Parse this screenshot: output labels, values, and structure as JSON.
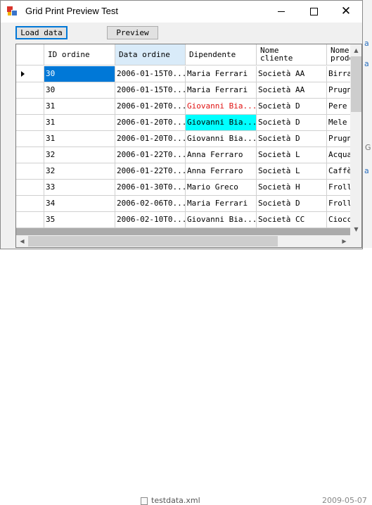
{
  "window": {
    "title": "Grid Print Preview Test",
    "minimize_glyph": "—",
    "maximize_glyph": "□",
    "close_glyph": "✕"
  },
  "toolbar": {
    "load_label": "Load data",
    "preview_label": "Preview"
  },
  "grid": {
    "columns": [
      {
        "label": "ID ordine",
        "selected": false
      },
      {
        "label": "Data ordine",
        "selected": true
      },
      {
        "label": "Dipendente",
        "selected": false
      },
      {
        "label": "Nome\ncliente",
        "selected": false
      },
      {
        "label": "Nome\nprodo",
        "selected": false
      }
    ],
    "rows": [
      {
        "current": true,
        "cells": [
          "30",
          "2006-01-15T0...",
          "Maria Ferrari",
          "Società AA",
          "Birra"
        ]
      },
      {
        "current": false,
        "cells": [
          "30",
          "2006-01-15T0...",
          "Maria Ferrari",
          "Società AA",
          "Prugn"
        ]
      },
      {
        "current": false,
        "cells": [
          "31",
          "2006-01-20T0...",
          "Giovanni Bia...",
          "Società D",
          "Pere s"
        ]
      },
      {
        "current": false,
        "cells": [
          "31",
          "2006-01-20T0...",
          "Giovanni Bia...",
          "Società D",
          "Mele s"
        ]
      },
      {
        "current": false,
        "cells": [
          "31",
          "2006-01-20T0...",
          "Giovanni Bia...",
          "Società D",
          "Prugn"
        ]
      },
      {
        "current": false,
        "cells": [
          "32",
          "2006-01-22T0...",
          "Anna Ferraro",
          "Società L",
          "Acqua"
        ]
      },
      {
        "current": false,
        "cells": [
          "32",
          "2006-01-22T0...",
          "Anna Ferraro",
          "Società L",
          "Caffè"
        ]
      },
      {
        "current": false,
        "cells": [
          "33",
          "2006-01-30T0...",
          "Mario Greco",
          "Società H",
          "Froll"
        ]
      },
      {
        "current": false,
        "cells": [
          "34",
          "2006-02-06T0...",
          "Maria Ferrari",
          "Società D",
          "Froll"
        ]
      },
      {
        "current": false,
        "cells": [
          "35",
          "2006-02-10T0...",
          "Giovanni Bia...",
          "Società CC",
          "Ciocc"
        ]
      }
    ],
    "colors": {
      "selected_cell_bg": "#0078d7",
      "red_text": "#e01010",
      "cyan_cell_bg": "#00ffff",
      "selected_header_bg": "#d9ebf9"
    },
    "scroll": {
      "up": "▲",
      "down": "▼",
      "left": "◀",
      "right": "▶"
    }
  },
  "background": {
    "right_fragments": [
      "a",
      "a",
      "G",
      "a"
    ],
    "file_name": "testdata.xml",
    "file_date": "2009-05-07"
  }
}
